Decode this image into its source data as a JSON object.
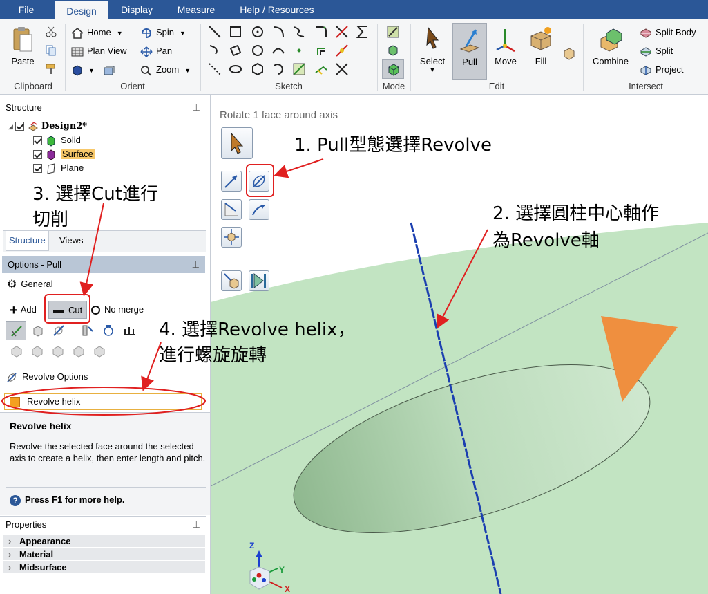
{
  "tabs": [
    "File",
    "Design",
    "Display",
    "Measure",
    "Help / Resources"
  ],
  "ribbon": {
    "clipboard": {
      "label": "Clipboard",
      "paste": "Paste"
    },
    "orient": {
      "label": "Orient",
      "home": "Home",
      "spin": "Spin",
      "plan_view": "Plan View",
      "pan": "Pan",
      "zoom": "Zoom"
    },
    "sketch": {
      "label": "Sketch"
    },
    "mode": {
      "label": "Mode"
    },
    "edit": {
      "label": "Edit",
      "select": "Select",
      "pull": "Pull",
      "move": "Move",
      "fill": "Fill"
    },
    "intersect": {
      "label": "Intersect",
      "combine": "Combine",
      "split_body": "Split Body",
      "split": "Split",
      "project": "Project"
    }
  },
  "structure": {
    "title": "Structure",
    "pin": "ᴘ",
    "root": "Design2*",
    "items": [
      "Solid",
      "Surface",
      "Plane"
    ],
    "tabs": [
      "Structure",
      "Views"
    ]
  },
  "options": {
    "title": "Options - Pull",
    "general": "General",
    "add": "Add",
    "cut": "Cut",
    "no_merge": "No merge",
    "revolve_options": "Revolve Options",
    "revolve_helix": "Revolve helix"
  },
  "help": {
    "title": "Revolve helix",
    "body": "Revolve the selected face around the selected axis to create a helix, then enter length and pitch.",
    "f1": "Press F1 for more help."
  },
  "properties": {
    "title": "Properties",
    "rows": [
      "Appearance",
      "Material",
      "Midsurface"
    ]
  },
  "viewport": {
    "hint": "Rotate 1 face around axis"
  },
  "annotations": {
    "a1": "1. Pull型態選擇Revolve",
    "a2_line1": "2. 選擇圓柱中心軸作",
    "a2_line2": "為Revolve軸",
    "a3_line1": "3. 選擇Cut進行",
    "a3_line2": "切削",
    "a4_line1": "4. 選擇Revolve helix，",
    "a4_line2": "進行螺旋旋轉"
  },
  "axes": {
    "z": "Z",
    "y": "Y",
    "x": "X"
  },
  "colors": {
    "tab_bar": "#2b5797",
    "annotation_red": "#e02020",
    "surface_green": "#bfe3bf",
    "triangle": "#ef8f3f",
    "axis_blue": "#1b3fb0"
  }
}
